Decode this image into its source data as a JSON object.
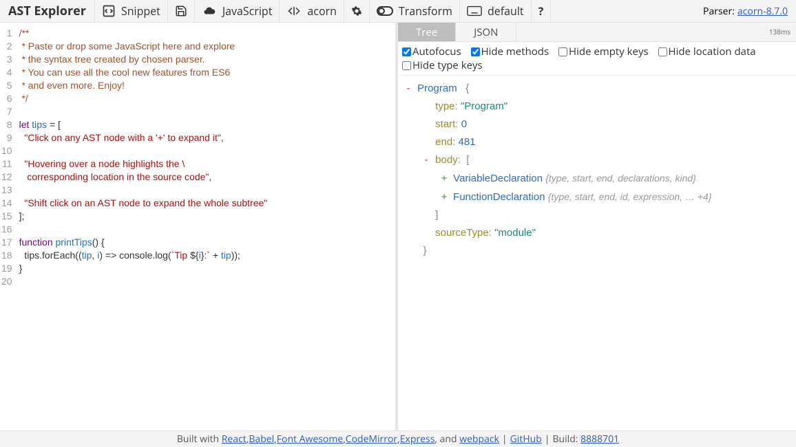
{
  "app_title": "AST Explorer",
  "toolbar": {
    "snippet": "Snippet",
    "language": "JavaScript",
    "parser": "acorn",
    "transform": "Transform",
    "tool": "default",
    "help": "?"
  },
  "parser_info": {
    "label": "Parser:",
    "name": "acorn-8.7.0"
  },
  "editor": {
    "lines": [
      {
        "n": 1,
        "raw": "/**",
        "cls": "c-comment"
      },
      {
        "n": 2,
        "raw": " * Paste or drop some JavaScript here and explore",
        "cls": "c-comment"
      },
      {
        "n": 3,
        "raw": " * the syntax tree created by chosen parser.",
        "cls": "c-comment"
      },
      {
        "n": 4,
        "raw": " * You can use all the cool new features from ES6",
        "cls": "c-comment"
      },
      {
        "n": 5,
        "raw": " * and even more. Enjoy!",
        "cls": "c-comment"
      },
      {
        "n": 6,
        "raw": " */",
        "cls": "c-comment"
      },
      {
        "n": 7,
        "raw": "",
        "cls": ""
      },
      {
        "n": 8,
        "segments": [
          {
            "t": "let ",
            "c": "c-key"
          },
          {
            "t": "tips",
            "c": "c-var"
          },
          {
            "t": " = [",
            "c": "c-pun"
          }
        ]
      },
      {
        "n": 9,
        "segments": [
          {
            "t": "  \"Click on any AST node with a '+' to expand it\"",
            "c": "c-str"
          },
          {
            "t": ",",
            "c": "c-pun"
          }
        ]
      },
      {
        "n": 10,
        "raw": "",
        "cls": ""
      },
      {
        "n": 11,
        "segments": [
          {
            "t": "  \"Hovering over a node highlights the \\",
            "c": "c-str"
          }
        ]
      },
      {
        "n": 12,
        "segments": [
          {
            "t": "   corresponding location in the source code\"",
            "c": "c-str"
          },
          {
            "t": ",",
            "c": "c-pun"
          }
        ]
      },
      {
        "n": 13,
        "raw": "",
        "cls": ""
      },
      {
        "n": 14,
        "segments": [
          {
            "t": "  \"Shift click on an AST node to expand the whole subtree\"",
            "c": "c-str"
          }
        ]
      },
      {
        "n": 15,
        "raw": "];",
        "cls": "c-pun"
      },
      {
        "n": 16,
        "raw": "",
        "cls": ""
      },
      {
        "n": 17,
        "segments": [
          {
            "t": "function ",
            "c": "c-key"
          },
          {
            "t": "printTips",
            "c": "c-var"
          },
          {
            "t": "() {",
            "c": "c-pun"
          }
        ]
      },
      {
        "n": 18,
        "segments": [
          {
            "t": "  tips.forEach((",
            "c": "c-pun"
          },
          {
            "t": "tip",
            "c": "c-var2"
          },
          {
            "t": ", ",
            "c": "c-pun"
          },
          {
            "t": "i",
            "c": "c-var2"
          },
          {
            "t": ") => console.log(",
            "c": "c-pun"
          },
          {
            "t": "`Tip ",
            "c": "c-tpl"
          },
          {
            "t": "${",
            "c": "c-pun"
          },
          {
            "t": "i",
            "c": "c-var2"
          },
          {
            "t": "}",
            "c": "c-pun"
          },
          {
            "t": ":` ",
            "c": "c-tpl"
          },
          {
            "t": "+ ",
            "c": "c-pun"
          },
          {
            "t": "tip",
            "c": "c-var2"
          },
          {
            "t": "));",
            "c": "c-pun"
          }
        ]
      },
      {
        "n": 19,
        "raw": "}",
        "cls": "c-pun"
      },
      {
        "n": 20,
        "raw": "",
        "cls": ""
      }
    ]
  },
  "output_tabs": {
    "tree": "Tree",
    "json": "JSON",
    "time": "138ms"
  },
  "filters": {
    "autofocus": {
      "label": "Autofocus",
      "checked": true
    },
    "hide_methods": {
      "label": "Hide methods",
      "checked": true
    },
    "hide_empty": {
      "label": "Hide empty keys",
      "checked": false
    },
    "hide_location": {
      "label": "Hide location data",
      "checked": false
    },
    "hide_type": {
      "label": "Hide type keys",
      "checked": false
    }
  },
  "tree": {
    "program": "Program",
    "type_key": "type",
    "type_val": "\"Program\"",
    "start_key": "start",
    "start_val": "0",
    "end_key": "end",
    "end_val": "481",
    "body_key": "body",
    "var_decl": "VariableDeclaration",
    "var_preview": "{type, start, end, declarations, kind}",
    "fn_decl": "FunctionDeclaration",
    "fn_preview": "{type, start, end, id, expression, … +4}",
    "source_key": "sourceType",
    "source_val": "\"module\""
  },
  "footer": {
    "built_with": "Built with",
    "react": "React",
    "babel": "Babel",
    "fontawesome": "Font Awesome",
    "codemirror": "CodeMirror",
    "express": "Express",
    "and": ", and",
    "webpack": "webpack",
    "github": "GitHub",
    "build_label": "Build:",
    "build": "8888701"
  }
}
